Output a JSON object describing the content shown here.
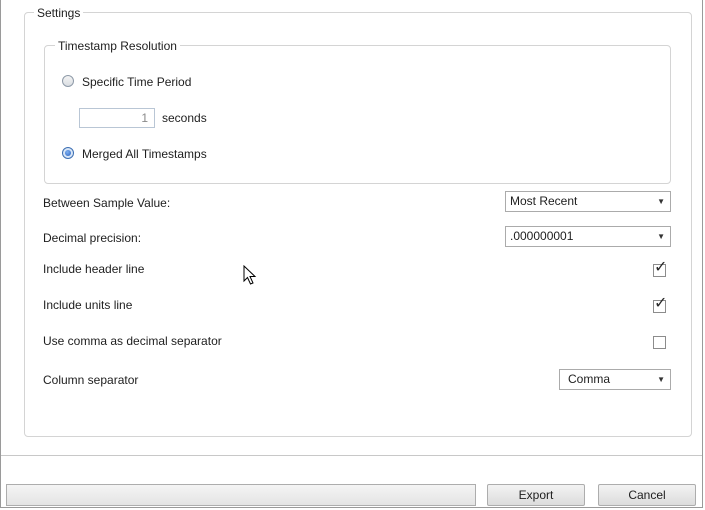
{
  "settings": {
    "title": "Settings",
    "timestamp_resolution": {
      "title": "Timestamp Resolution",
      "specific_label": "Specific Time Period",
      "specific_selected": false,
      "period_value": "1",
      "period_unit": "seconds",
      "merged_label": "Merged All Timestamps",
      "merged_selected": true
    },
    "between_sample": {
      "label": "Between Sample Value:",
      "value": "Most Recent"
    },
    "decimal_precision": {
      "label": "Decimal precision:",
      "value": ".000000001"
    },
    "include_header": {
      "label": "Include header line",
      "checked": true,
      "mark": "✓"
    },
    "include_units": {
      "label": "Include units line",
      "checked": true,
      "mark": "✓"
    },
    "use_comma": {
      "label": "Use comma as decimal separator",
      "checked": false,
      "mark": ""
    },
    "column_separator": {
      "label": "Column separator",
      "value": "Comma"
    }
  },
  "footer": {
    "status_text": "",
    "export_label": "Export",
    "cancel_label": "Cancel"
  },
  "icons": {
    "dropdown": "chevron-down-icon",
    "cursor": "mouse-pointer-icon"
  }
}
